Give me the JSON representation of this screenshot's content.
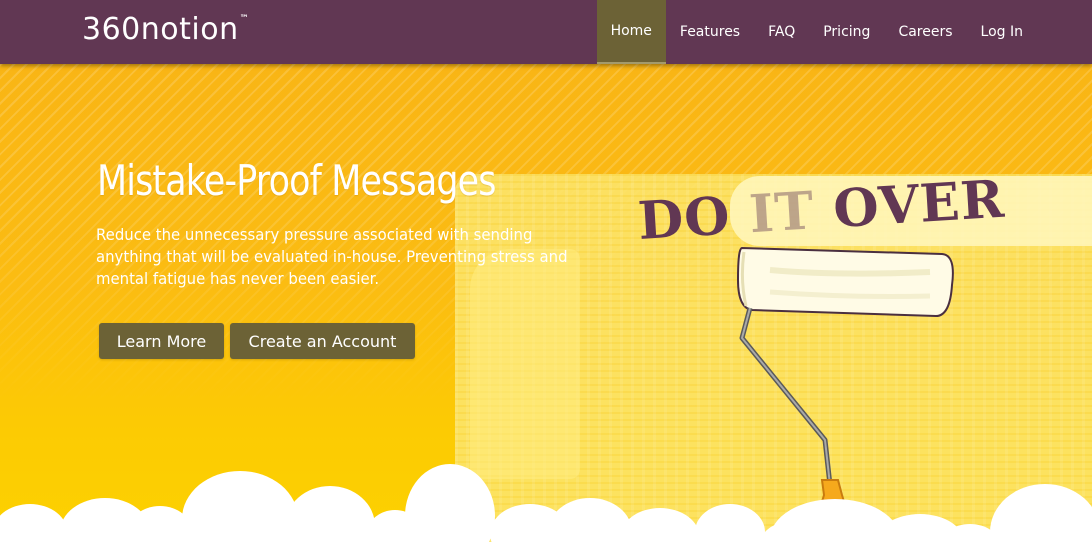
{
  "brand": {
    "logo_text": "360notion",
    "trademark": "™"
  },
  "nav": {
    "items": [
      {
        "label": "Home",
        "active": true
      },
      {
        "label": "Features",
        "active": false
      },
      {
        "label": "FAQ",
        "active": false
      },
      {
        "label": "Pricing",
        "active": false
      },
      {
        "label": "Careers",
        "active": false
      },
      {
        "label": "Log In",
        "active": false
      }
    ]
  },
  "hero": {
    "title": "Mistake-Proof Messages",
    "subtitle": "Reduce the unnecessary pressure associated with sending anything that will be evaluated in-house. Preventing stress and mental fatigue has never been easier.",
    "buttons": {
      "learn_more": "Learn More",
      "create_account": "Create an Account"
    },
    "illustration_text": {
      "word1": "DO",
      "word2": "IT",
      "word3": "OVER"
    }
  },
  "colors": {
    "nav_bg": "#613753",
    "nav_active_bg": "#6c6236",
    "hero_bg_top": "#f9b515",
    "hero_bg_bottom": "#fdd200",
    "button_bg": "#6c6236",
    "illustration_text": "#613753"
  },
  "icons": {
    "illustration": "paint-roller-icon"
  }
}
